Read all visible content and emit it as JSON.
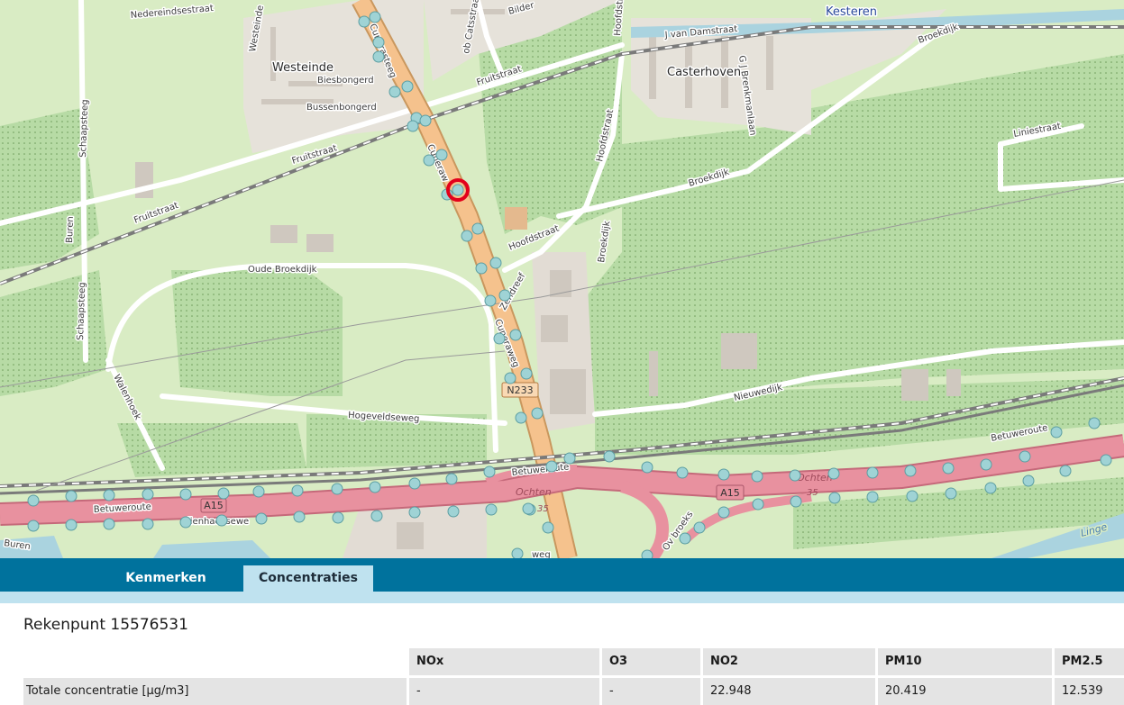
{
  "map": {
    "places": {
      "westeinde": "Westeinde",
      "casterhoven": "Casterhoven",
      "kesteren": "Kesteren"
    },
    "streets": {
      "nedereindsestraat": "Nedereindsestraat",
      "bildersstraat": "Bilder",
      "cats": "ob Catsstraat",
      "fruitstraat_ne": "Fruitstraat",
      "fruitstraat_w": "Fruitstraat",
      "fruitstraat_sw": "Fruitstraat",
      "westeinde_st": "Westeinde",
      "biesbongerd": "Biesbongerd",
      "bussenbongerd": "Bussenbongerd",
      "schaapsteeg_n": "Schaapsteeg",
      "schaapsteeg_s": "Schaapsteeg",
      "buren": "Buren",
      "buren_s": "Buren",
      "cuneraweg_n": "Cunerasteeg",
      "cuneraweg_mid": "Cuneraw",
      "cuneraweg_s": "Cuneraweg",
      "hoofdstraat_n": "Hoofdstraat",
      "hoofdstraat_mid": "Hoofdstraat",
      "hoofdstraat_w": "Hoofdstraat",
      "vandamstraat": "J van Damstraat",
      "brenkmanlaan": "G J Brenkmanlaan",
      "broekdijk_n": "Broekdijk",
      "broekdijk_mid": "Broekdijk",
      "broekdijk_s": "Broekdijk",
      "liniestraat": "Liniestraat",
      "oude_broekdijk": "Oude Broekdijk",
      "zendreef": "Zendreef",
      "nieuwedijk": "Nieuwedijk",
      "hogeveldseweg": "Hogeveldseweg",
      "walenhoek": "Walenhoek",
      "betuweroute_w": "Betuweroute",
      "betuweroute_mid": "Betuweroute",
      "betuweroute_e": "Betuweroute",
      "lienhaeksewe": "lienhaeksewe",
      "ochten_s": "Ochten",
      "ochten_e": "Ochten",
      "overbroek": "Ov broeks",
      "pleeg": "weg",
      "linge": "Linge"
    },
    "shields": {
      "a15_w": "A15",
      "a15_e": "A15",
      "n233": "N233",
      "exit_35_w": "35",
      "exit_35_e": "35"
    },
    "colors": {
      "background": "#d9ecc4",
      "motorway": "#e8919f",
      "trunk": "#f5c28d",
      "selected_point": "#e3001b",
      "point": "#9fd3d5"
    }
  },
  "tabs": {
    "kenmerken": "Kenmerken",
    "concentraties": "Concentraties",
    "active": "Concentraties"
  },
  "panel": {
    "title": "Rekenpunt 15576531",
    "columns": [
      "",
      "NOx",
      "O3",
      "NO2",
      "PM10",
      "PM2.5"
    ],
    "rows": [
      {
        "label": "Totale concentratie [µg/m3]",
        "values": [
          "-",
          "-",
          "22.948",
          "20.419",
          "12.539"
        ]
      }
    ]
  }
}
